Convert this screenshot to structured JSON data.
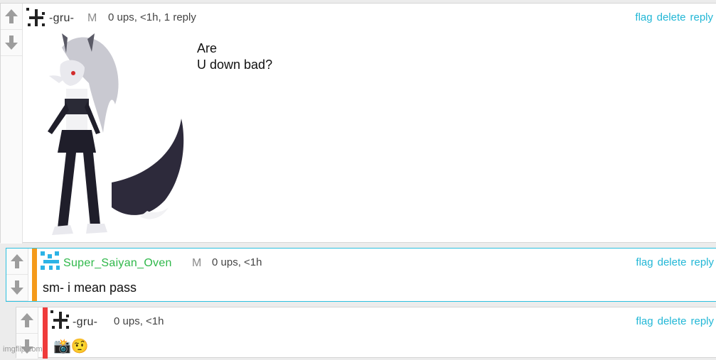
{
  "comment1": {
    "username": "-gru-",
    "mod_badge": "M",
    "meta": "0 ups, <1h, 1 reply",
    "text": "Are\nU down bad?",
    "actions": [
      "flag",
      "delete",
      "reply"
    ],
    "image_label": "wolf-girl character image"
  },
  "comment2": {
    "username": "Super_Saiyan_Oven",
    "mod_badge": "M",
    "meta": "0 ups, <1h",
    "text": "sm- i mean pass",
    "actions": [
      "flag",
      "delete",
      "reply"
    ]
  },
  "comment3": {
    "username": "-gru-",
    "meta": "0 ups, <1h",
    "text": "📸🤨",
    "actions": [
      "flag",
      "delete",
      "reply"
    ]
  },
  "watermark": "imgflip.com",
  "colors": {
    "link": "#22b7d6",
    "green_username": "#2fb84a",
    "orange_accent": "#f59a1a",
    "red_accent": "#ef3b3b",
    "highlight_border": "#2cc0e0"
  }
}
